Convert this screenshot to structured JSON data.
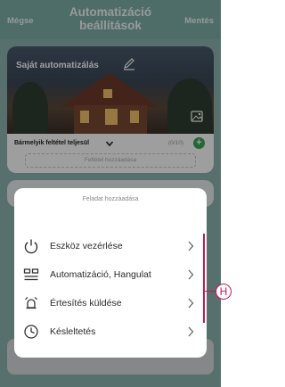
{
  "header": {
    "cancel_label": "Mégse",
    "title": "Automatizáció beállítások",
    "save_label": "Mentés"
  },
  "automation": {
    "name": "Saját automatizálás",
    "condition_mode": "Bármelyik feltétel teljesül",
    "condition_count": "(0/10)",
    "add_condition_label": "Feltétel hozzáadása"
  },
  "sheet": {
    "title": "Feladat hozzáadása",
    "items": [
      {
        "label": "Eszköz vezérlése",
        "icon": "power-icon"
      },
      {
        "label": "Automatizáció, Hangulat",
        "icon": "automation-icon"
      },
      {
        "label": "Értesítés küldése",
        "icon": "alarm-icon"
      },
      {
        "label": "Késleltetés",
        "icon": "clock-icon"
      }
    ]
  },
  "annotation": {
    "badge": "H"
  },
  "colors": {
    "header_bg": "#7fb1aa",
    "add_green": "#3aa558",
    "annotation": "#c2185b"
  }
}
